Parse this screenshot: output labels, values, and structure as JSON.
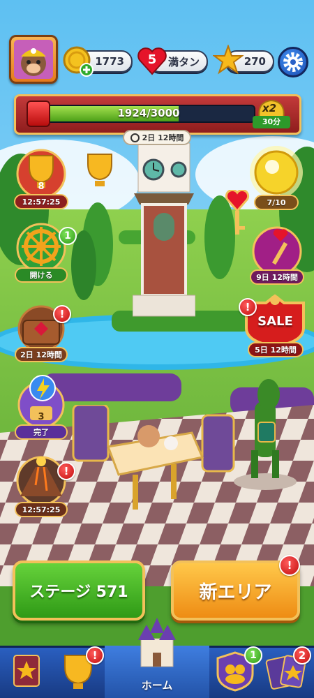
{
  "hud": {
    "coins": "1773",
    "lives_count": "5",
    "lives_text": "満タン",
    "stars": "270"
  },
  "progress": {
    "text": "1924/3000",
    "fraction": 0.641,
    "multiplier": "x2",
    "multiplier_time": "30分",
    "timer": "2日 12時間"
  },
  "left_events": [
    {
      "name": "trophy-event",
      "label": "12:57:25",
      "count": "8"
    },
    {
      "name": "wheel-event",
      "label": "開ける",
      "badge": "1"
    },
    {
      "name": "chest-event",
      "label": "2日 12時間"
    },
    {
      "name": "lightning-event",
      "label": "完了",
      "count": "3"
    },
    {
      "name": "volcano-event",
      "label": "12:57:25"
    }
  ],
  "right_events": [
    {
      "name": "orb-event",
      "label": "7/10"
    },
    {
      "name": "key-event",
      "label": "9日 12時間"
    },
    {
      "name": "sale-event",
      "title": "SALE",
      "label": "5日 12時間"
    }
  ],
  "buttons": {
    "stage": "ステージ 571",
    "new_area": "新エリア"
  },
  "nav": {
    "home": "ホーム",
    "team_badge": "1",
    "cards_badge": "2"
  },
  "colors": {
    "stage_green": "#3fb21c",
    "new_area_orange": "#f6a21c",
    "nav_blue": "#1d4fa8",
    "alert_red": "#d61515"
  }
}
